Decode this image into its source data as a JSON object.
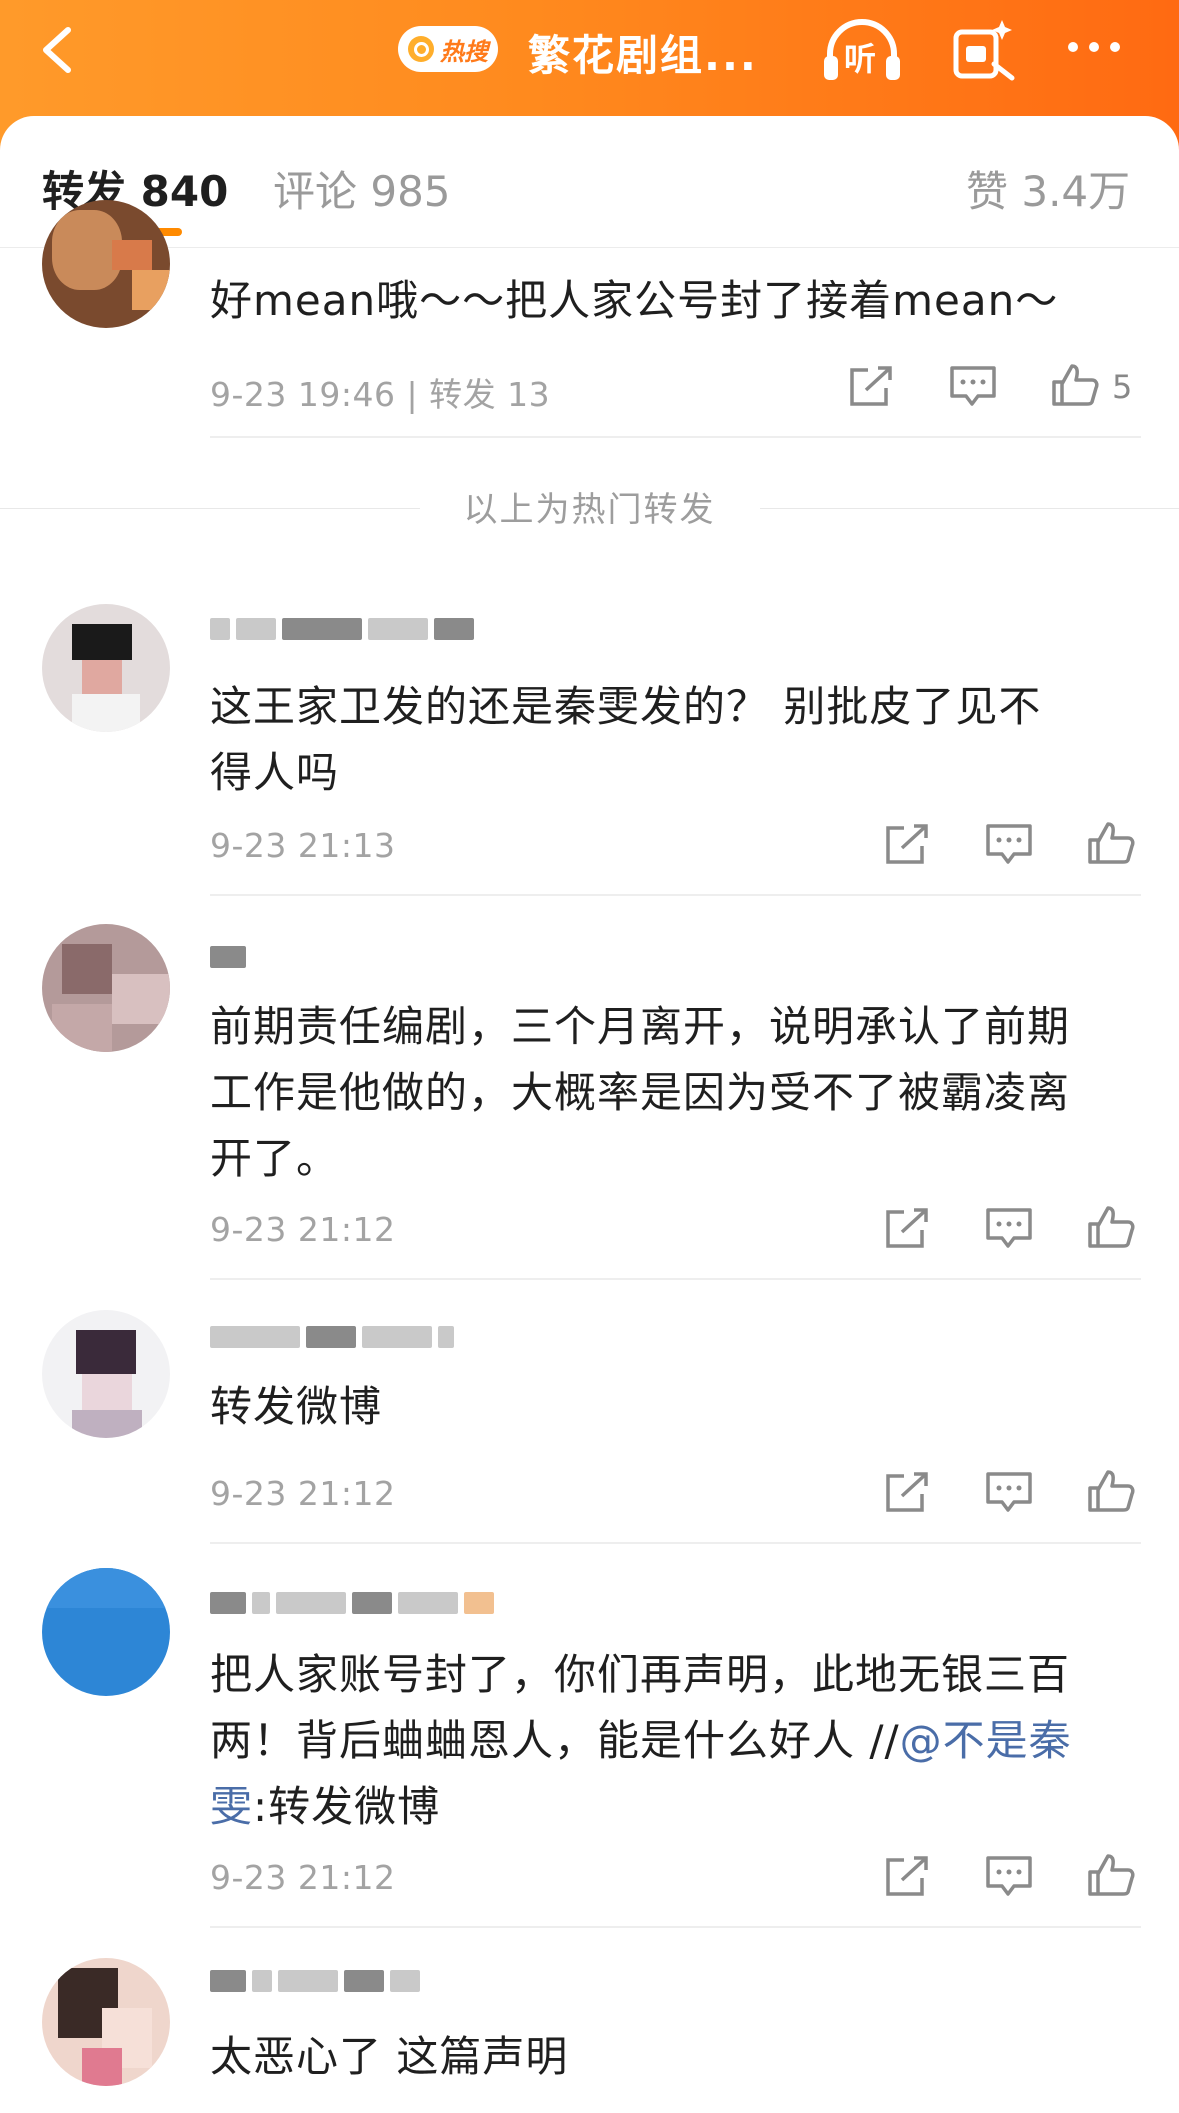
{
  "header": {
    "hot_label": "热搜",
    "title": "繁花剧组...",
    "listen_label": "听",
    "colors": {
      "bar_start": "#ff9a2a",
      "bar_end": "#ff6a12",
      "accent": "#ff8a00"
    }
  },
  "tabs": {
    "repost": "转发 840",
    "comment": "评论 985",
    "like": "赞 3.4万"
  },
  "posts": [
    {
      "content": "好mean哦～～把人家公号封了接着mean～",
      "meta": "9-23 19:46 | 转发 13",
      "like_count": "5"
    },
    {
      "content_lines": [
        "这王家卫发的还是秦雯发的？ 别批皮了见不",
        "得人吗"
      ],
      "meta": "9-23 21:13"
    },
    {
      "content_lines": [
        "前期责任编剧，三个月离开，说明承认了前期",
        "工作是他做的，大概率是因为受不了被霸凌离",
        "开了。"
      ],
      "meta": "9-23 21:12"
    },
    {
      "content": "转发微博",
      "meta": "9-23 21:12"
    },
    {
      "content_lines": [
        "把人家账号封了，你们再声明，此地无银三百",
        "两！背后蛐蛐恩人，能是什么好人 //"
      ],
      "mention_line2": "@不是秦",
      "mention_line3": "雯",
      "tail": ":转发微博",
      "meta": "9-23 21:12"
    },
    {
      "content": "太恶心了 这篇声明"
    }
  ],
  "hot_separator": "以上为热门转发",
  "icons": [
    "back-icon",
    "search-icon",
    "headphones-icon",
    "gift-icon",
    "more-icon",
    "repost-icon",
    "comment-icon",
    "like-icon"
  ]
}
